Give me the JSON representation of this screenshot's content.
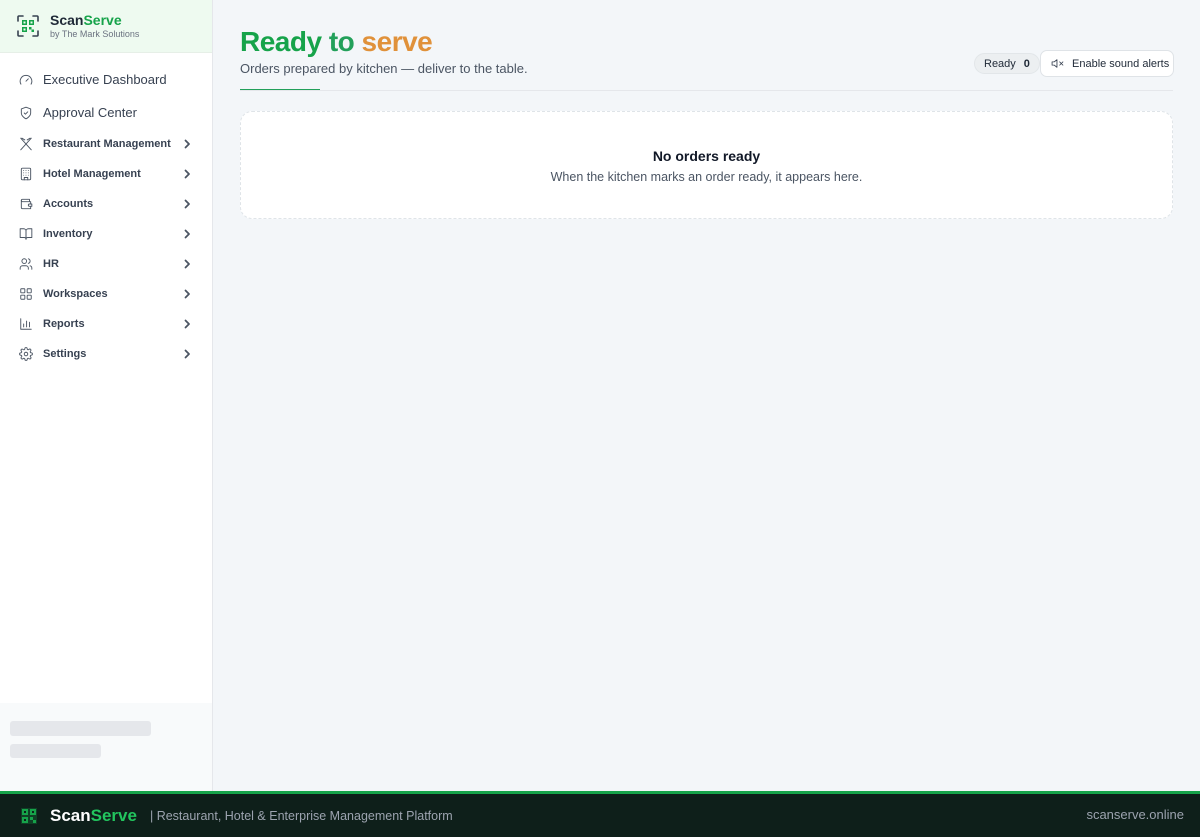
{
  "brand": {
    "name_part1": "Scan",
    "name_part2": "Serve",
    "tagline": "by The Mark Solutions"
  },
  "sidebar": {
    "top_items": [
      {
        "label": "Executive Dashboard",
        "icon": "gauge-icon"
      },
      {
        "label": "Approval Center",
        "icon": "shield-check-icon"
      }
    ],
    "items": [
      {
        "label": "Restaurant Management",
        "icon": "utensils-icon"
      },
      {
        "label": "Hotel Management",
        "icon": "building-icon"
      },
      {
        "label": "Accounts",
        "icon": "wallet-icon"
      },
      {
        "label": "Inventory",
        "icon": "book-icon"
      },
      {
        "label": "HR",
        "icon": "users-icon"
      },
      {
        "label": "Workspaces",
        "icon": "grid-icon"
      },
      {
        "label": "Reports",
        "icon": "bar-chart-icon"
      },
      {
        "label": "Settings",
        "icon": "gear-icon"
      }
    ]
  },
  "page": {
    "title_word1": "Ready",
    "title_word2": "to",
    "title_word3": "serve",
    "subtitle": "Orders prepared by kitchen — deliver to the table.",
    "ready_label": "Ready",
    "ready_count": "0",
    "sound_button_label": "Enable sound alerts"
  },
  "empty_state": {
    "title": "No orders ready",
    "description": "When the kitchen marks an order ready, it appears here."
  },
  "footer": {
    "name_part1": "Scan",
    "name_part2": "Serve",
    "tagline": "| Restaurant, Hotel & Enterprise Management Platform",
    "url": "scanserve.online"
  },
  "colors": {
    "brand_green": "#16a34a",
    "accent_orange": "#e0913a",
    "footer_bg": "#0e1f1a"
  }
}
